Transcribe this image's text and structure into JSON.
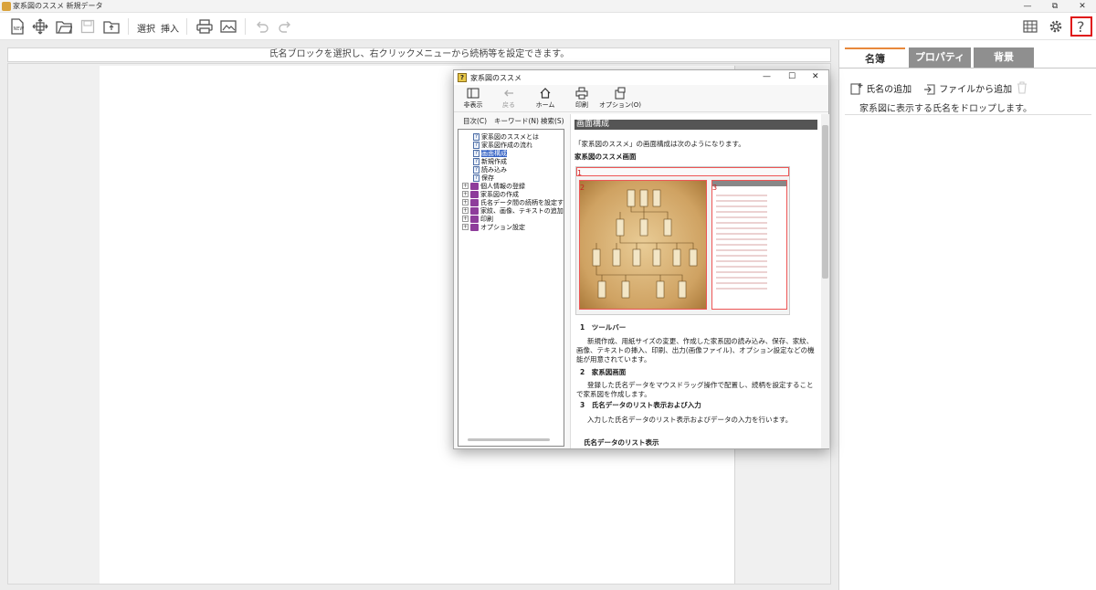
{
  "window": {
    "title": "家系図のススメ 新規データ",
    "minimize": "—",
    "maximize": "⧉",
    "close": "✕"
  },
  "toolbar": {
    "select_label": "選択",
    "insert_label": "挿入"
  },
  "canvas": {
    "hint": "氏名ブロックを選択し、右クリックメニューから続柄等を設定できます。"
  },
  "rightpanel": {
    "tabs": [
      "名簿",
      "プロパティ",
      "背景"
    ],
    "add_name": "氏名の追加",
    "add_from_file": "ファイルから追加",
    "drop_hint": "家系図に表示する氏名をドロップします。"
  },
  "help": {
    "title": "家系図のススメ",
    "tools": [
      "非表示",
      "戻る",
      "ホーム",
      "印刷",
      "オプション(O)"
    ],
    "left_tabs": [
      "目次(C)",
      "キーワード(N)",
      "検索(S)"
    ],
    "tree": [
      {
        "label": "家系図のススメとは",
        "kind": "page"
      },
      {
        "label": "家系図作成の流れ",
        "kind": "page"
      },
      {
        "label": "画面構成",
        "kind": "page",
        "selected": true
      },
      {
        "label": "新規作成",
        "kind": "page"
      },
      {
        "label": "読み込み",
        "kind": "page"
      },
      {
        "label": "保存",
        "kind": "page"
      },
      {
        "label": "個人情報の登録",
        "kind": "book"
      },
      {
        "label": "家系図の作成",
        "kind": "book"
      },
      {
        "label": "氏名データ間の続柄を設定す",
        "kind": "book"
      },
      {
        "label": "家紋、画像、テキストの追加",
        "kind": "book"
      },
      {
        "label": "印刷",
        "kind": "book"
      },
      {
        "label": "オプション設定",
        "kind": "book"
      }
    ],
    "content": {
      "heading": "画面構成",
      "intro": "「家系図のススメ」の画面構成は次のようになります。",
      "subheading": "家系図のススメ画面",
      "markers": [
        "1",
        "2",
        "3"
      ],
      "s1_title": "1　ツールバー",
      "s1_body": "新規作成、用紙サイズの変更、作成した家系図の読み込み、保存、家紋、画像、テキストの挿入、印刷、出力(画像ファイル)、オプション設定などの機能が用意されています。",
      "s2_title": "2　家系図画面",
      "s2_body": "登録した氏名データをマウスドラッグ操作で配置し、続柄を設定することで家系図を作成します。",
      "s3_title": "3　氏名データのリスト表示および入力",
      "s3_body": "入力した氏名データのリスト表示およびデータの入力を行います。",
      "s4_title": "氏名データのリスト表示"
    }
  },
  "colors": {
    "accent": "#e8883b",
    "help_highlight": "#e01515",
    "tab_inactive": "#8f8f8f"
  }
}
